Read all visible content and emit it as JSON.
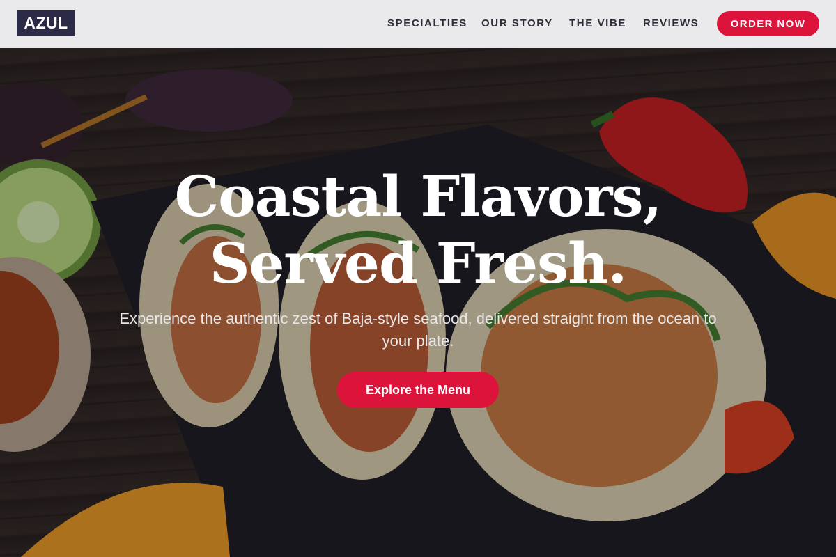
{
  "brand": {
    "logo_text": "AZUL",
    "accent_color": "#dc143c",
    "logo_bg_color": "#2b2b48"
  },
  "nav": {
    "items": [
      {
        "label": "SPECIALTIES"
      },
      {
        "label": "OUR STORY"
      },
      {
        "label": "THE VIBE"
      },
      {
        "label": "REVIEWS"
      }
    ],
    "cta_label": "ORDER NOW"
  },
  "hero": {
    "title_line1": "Coastal Flavors,",
    "title_line2": "Served Fresh.",
    "subtitle": "Experience the authentic zest of Baja-style seafood, delivered straight from the ocean to your plate.",
    "cta_label": "Explore the Menu",
    "background_image": "tacos-photo"
  }
}
